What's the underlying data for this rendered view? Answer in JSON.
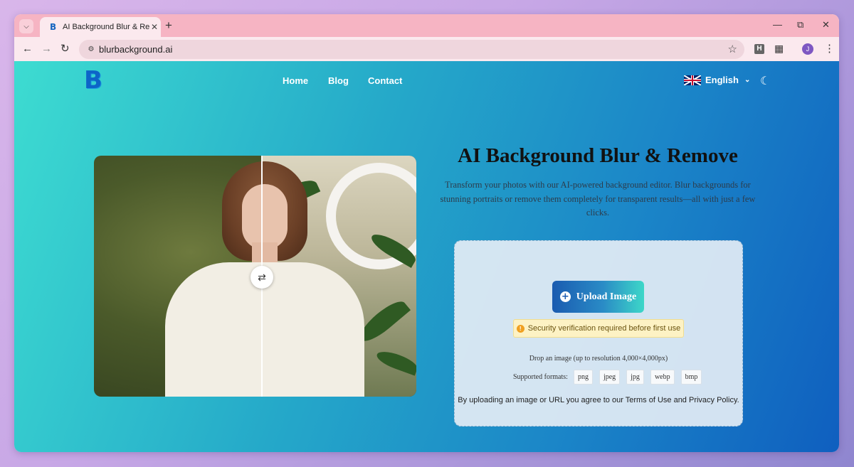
{
  "browser": {
    "tab_title": "AI Background Blur & Remove",
    "tab_favicon": "B",
    "url": "blurbackground.ai",
    "extension_letter": "H",
    "avatar_initial": "J"
  },
  "nav": {
    "links": [
      "Home",
      "Blog",
      "Contact"
    ],
    "language": "English",
    "logo_letter": "B"
  },
  "hero": {
    "title": "AI Background Blur & Remove",
    "description": "Transform your photos with our AI-powered background editor. Blur backgrounds for stunning portraits or remove them completely for transparent results—all with just a few clicks."
  },
  "upload": {
    "button_label": "Upload Image",
    "security_notice": "Security verification required before first use",
    "drop_text": "Drop an image (up to resolution 4,000×4,000px)",
    "formats_label": "Supported formats:",
    "formats": [
      "png",
      "jpeg",
      "jpg",
      "webp",
      "bmp"
    ],
    "agreement": "By uploading an image or URL you agree to our Terms of Use and Privacy Policy."
  },
  "icons": {
    "tab_search": "chevron-down-icon",
    "tab_close": "close-icon",
    "new_tab": "plus-icon",
    "back": "arrow-left-icon",
    "forward": "arrow-right-icon",
    "reload": "reload-icon",
    "site_info": "tune-icon",
    "bookmark": "star-icon",
    "extensions": "puzzle-icon",
    "menu": "kebab-icon",
    "compare": "swap-arrows-icon",
    "theme": "moon-icon",
    "warning": "warning-icon"
  },
  "colors": {
    "tab_strip": "#f6b4c3",
    "page_gradient_start": "#3ddcd1",
    "page_gradient_end": "#0f5fbf",
    "upload_button": "#1a5bb0"
  }
}
